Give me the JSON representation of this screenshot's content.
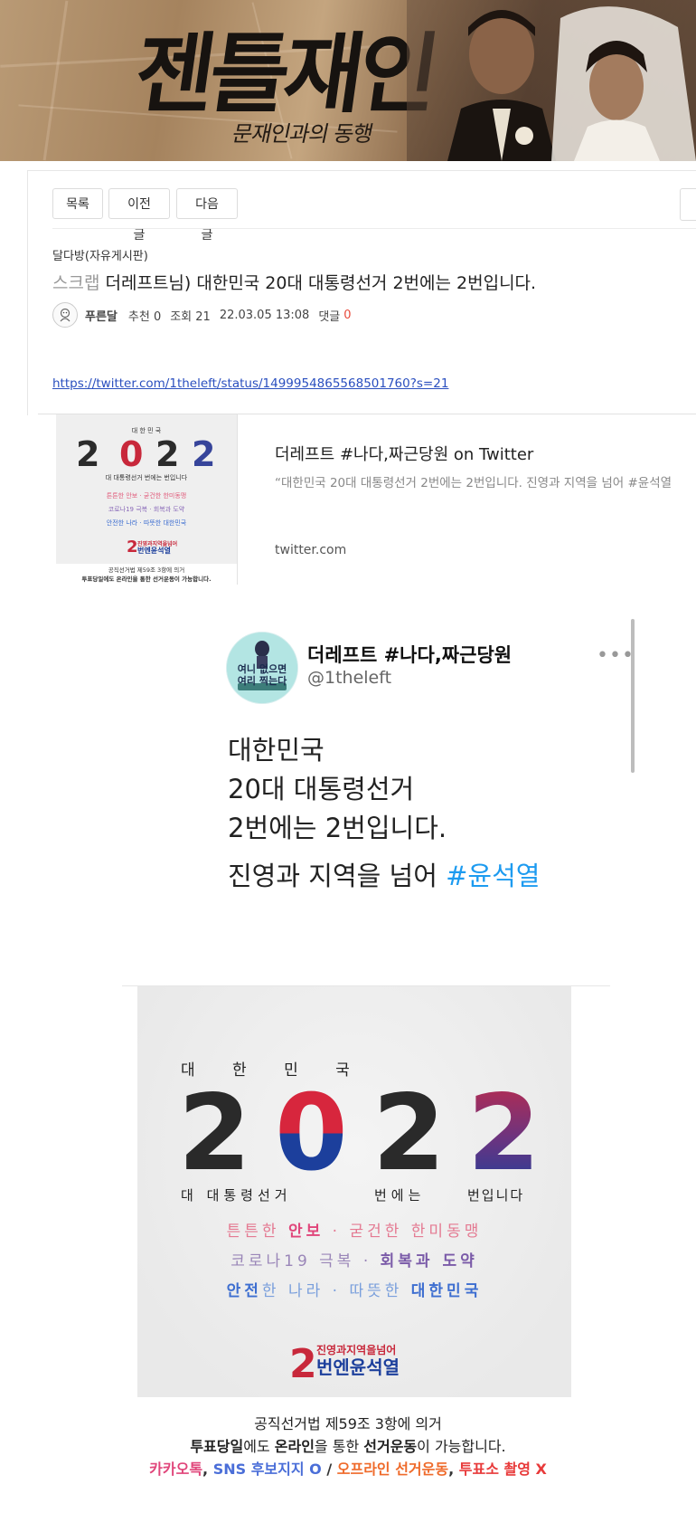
{
  "banner": {
    "title": "젠틀재인",
    "subtitle": "문재인과의 동행"
  },
  "nav": {
    "list_label": "목록",
    "prev_label": "이전글",
    "next_label": "다음글"
  },
  "post": {
    "board": "달다방(자유게시판)",
    "scrap_label": "스크랩",
    "title": "더레프트님) 대한민국 20대 대통령선거 2번에는 2번입니다.",
    "author": "푸른달",
    "recommend": "추천 0",
    "views": "조회 21",
    "date": "22.03.05 13:08",
    "comment_label": "댓글",
    "comment_count": "0",
    "link": "https://twitter.com/1theleft/status/1499954865568501760?s=21"
  },
  "og_card": {
    "title": "더레프트 #나다,짜근당원 on Twitter",
    "description": "“대한민국 20대 대통령선거 2번에는 2번입니다. 진영과 지역을 넘어 #윤석열",
    "domain": "twitter.com",
    "thumb_caption1": "공직선거법 제59조 3항에 의거",
    "thumb_caption2": "투표당일에도 온라인을 통한 선거운동이 가능합니다."
  },
  "tweet": {
    "name": "더레프트 #나다,짜근당원",
    "handle": "@1theleft",
    "more": "•••",
    "line1": "대한민국",
    "line2": "20대 대통령선거",
    "line3": "2번에는 2번입니다.",
    "line4": "진영과 지역을 넘어 ",
    "hashtag": "#윤석열",
    "avatar_text1": "여니 없으면",
    "avatar_text2": "여리 찍는다"
  },
  "poster": {
    "top_label": "대 한 민 국",
    "year": [
      "2",
      "0",
      "2",
      "2"
    ],
    "sub_label_a": "대  대통령선거",
    "sub_label_b": "번에는",
    "sub_label_c": "번입니다",
    "line1_a": "튼튼한 ",
    "line1_b": "안보",
    "line1_c": " · 굳건한 한미동맹",
    "line2_a": "코로나19 극복 · ",
    "line2_b": "회복과 도약",
    "line3_a": "안전",
    "line3_b": "한 나라 · 따뜻한 ",
    "line3_c": "대한민국",
    "logo_num": "2",
    "logo_top": "진영과지역을넘어",
    "logo_bottom": "번엔윤석열"
  },
  "captions": {
    "line1": "공직선거법 제59조 3항에 의거",
    "line2_a": "투표당일",
    "line2_b": "에도 ",
    "line2_c": "온라인",
    "line2_d": "을 통한 ",
    "line2_e": "선거운동",
    "line2_f": "이 가능합니다.",
    "line3_a": "카카오톡",
    "line3_b": ", ",
    "line3_c": "SNS 후보지지 O",
    "line3_d": " / ",
    "line3_e": "오프라인 선거운동",
    "line3_f": ", ",
    "line3_g": "투표소 촬영 X"
  },
  "colors": {
    "link_blue": "#2a4fbf",
    "comment_red": "#e84a3b",
    "twitter_blue": "#1d9bf0",
    "poster_red": "#d7263d",
    "poster_navy": "#1c3f9c",
    "poster_dark": "#222222"
  }
}
